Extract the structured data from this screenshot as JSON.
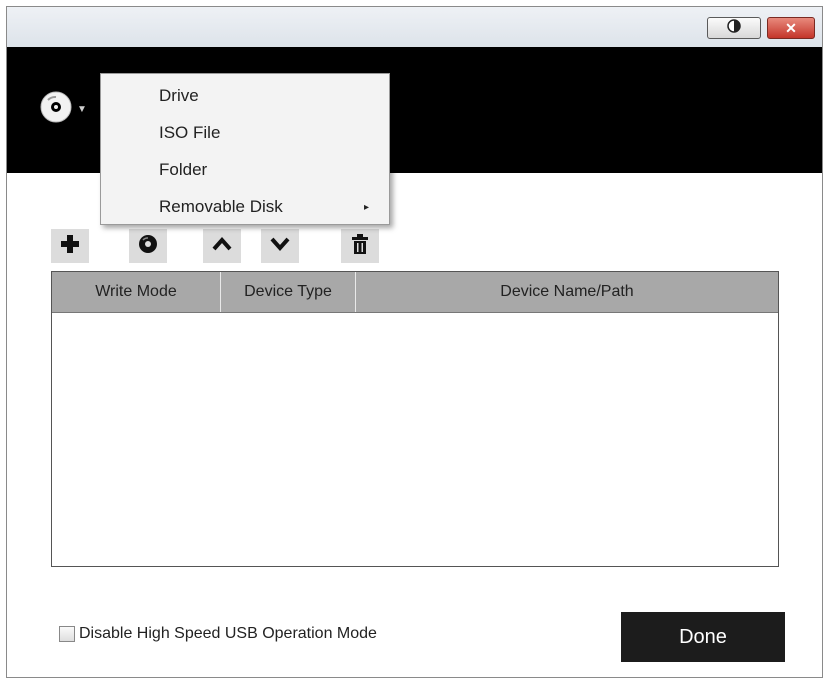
{
  "window": {
    "theme_icon": "contrast-toggle-icon",
    "close_label": "✕"
  },
  "header": {
    "source_icon": "disc-icon",
    "dropdown_icon": "chevron-down-icon"
  },
  "source_menu": {
    "items": [
      {
        "label": "Drive"
      },
      {
        "label": "ISO File"
      },
      {
        "label": "Folder"
      },
      {
        "label": "Removable Disk",
        "submenu_arrow": "▸"
      }
    ]
  },
  "toolbar": {
    "icons": [
      "plus-icon",
      "disc-icon",
      "chevron-up-icon",
      "chevron-down-icon",
      "trash-icon"
    ]
  },
  "table": {
    "columns": [
      "Write Mode",
      "Device Type",
      "Device Name/Path"
    ],
    "rows": []
  },
  "footer": {
    "checkbox_label": "Disable High Speed USB Operation Mode",
    "checkbox_checked": false,
    "done_label": "Done"
  }
}
